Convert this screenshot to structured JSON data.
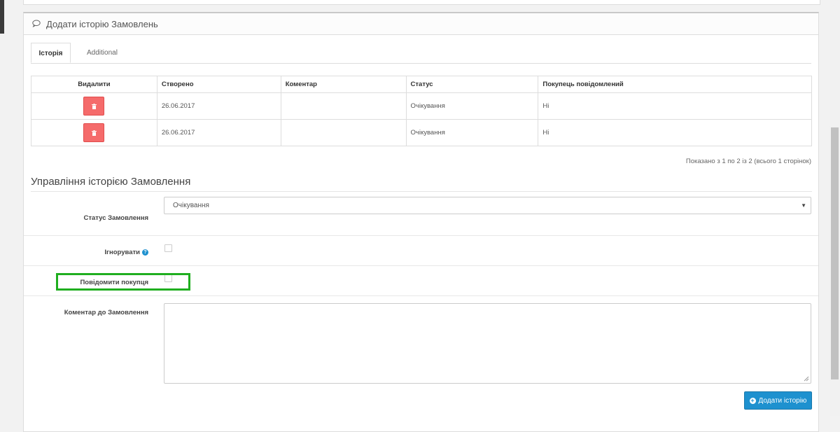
{
  "panel": {
    "title": "Додати історію Замовлень",
    "icon": "comment-icon"
  },
  "tabs": [
    {
      "label": "Історія",
      "active": true
    },
    {
      "label": "Additional",
      "active": false
    }
  ],
  "history_table": {
    "headers": [
      "Видалити",
      "Створено",
      "Коментар",
      "Статус",
      "Покупець повідомлений"
    ],
    "rows": [
      {
        "created": "26.06.2017",
        "comment": "",
        "status": "Очікування",
        "notified": "Ні"
      },
      {
        "created": "26.06.2017",
        "comment": "",
        "status": "Очікування",
        "notified": "Ні"
      }
    ]
  },
  "pagination": {
    "text": "Показано з 1 по 2 із 2 (всього 1 сторінок)"
  },
  "manage": {
    "title": "Управління історією Замовлення",
    "status_label": "Статус Замовлення",
    "status_value": "Очікування",
    "ignore_label": "Ігнорувати",
    "notify_label": "Повідомити покупця",
    "comment_label": "Коментар до Замовлення",
    "comment_value": "",
    "add_button": "Додати історію"
  },
  "colors": {
    "danger": "#f56b6b",
    "primary": "#1e91cf",
    "highlight": "#1fae1f"
  }
}
